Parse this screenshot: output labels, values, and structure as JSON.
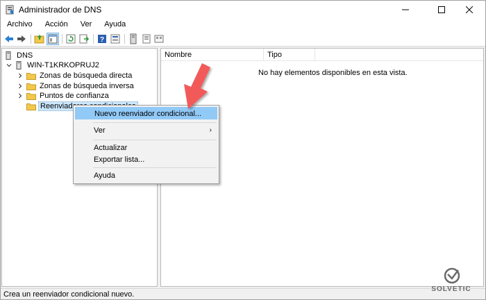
{
  "window": {
    "title": "Administrador de DNS"
  },
  "menubar": {
    "items": [
      {
        "label": "Archivo"
      },
      {
        "label": "Acción"
      },
      {
        "label": "Ver"
      },
      {
        "label": "Ayuda"
      }
    ]
  },
  "toolbar": {
    "icons": [
      "back-icon",
      "forward-icon",
      "up-folder-icon",
      "console-tree-icon",
      "refresh-icon",
      "export-list-icon",
      "help-icon",
      "properties-icon",
      "server-icon",
      "lookup-icon",
      "forward-zone-icon"
    ]
  },
  "tree": {
    "root": {
      "label": "DNS"
    },
    "server": {
      "label": "WIN-T1KRKOPRUJ2"
    },
    "items": [
      {
        "label": "Zonas de búsqueda directa"
      },
      {
        "label": "Zonas de búsqueda inversa"
      },
      {
        "label": "Puntos de confianza"
      },
      {
        "label": "Reenviadores condicionales"
      }
    ]
  },
  "list": {
    "columns": [
      {
        "label": "Nombre"
      },
      {
        "label": "Tipo"
      }
    ],
    "empty_message": "No hay elementos disponibles en esta vista."
  },
  "context_menu": {
    "items": [
      {
        "label": "Nuevo reenviador condicional..."
      },
      {
        "label": "Ver"
      },
      {
        "label": "Actualizar"
      },
      {
        "label": "Exportar lista..."
      },
      {
        "label": "Ayuda"
      }
    ]
  },
  "status": {
    "text": "Crea un reenviador condicional nuevo."
  },
  "watermark": {
    "text": "SOLVETIC"
  },
  "colors": {
    "highlight": "#91c9f7",
    "arrow": "#f25a5a",
    "folder": "#f2c94c"
  }
}
